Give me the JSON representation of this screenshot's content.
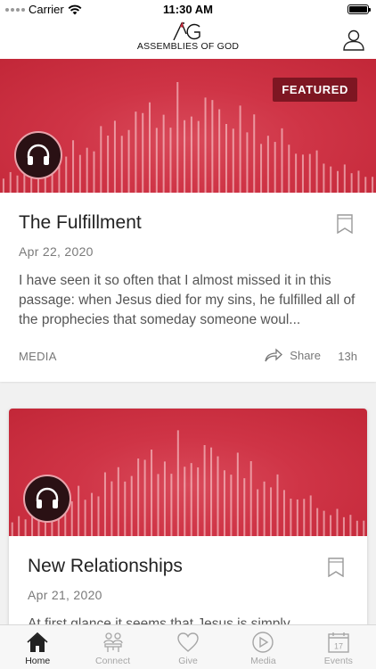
{
  "status_bar": {
    "carrier": "Carrier",
    "time": "11:30 AM"
  },
  "header": {
    "logo_text": "ASSEMBLIES OF GOD",
    "logo_mark": "AG"
  },
  "cards": [
    {
      "badge": "FEATURED",
      "title": "The Fulfillment",
      "date": "Apr 22, 2020",
      "excerpt": "I have seen it so often that I almost missed it in this passage: when Jesus died for my sins, he fulfilled all of the prophecies that someday someone woul...",
      "media_label": "MEDIA",
      "share_label": "Share",
      "age": "13h"
    },
    {
      "title": "New Relationships",
      "date": "Apr 21, 2020",
      "excerpt": "At first glance it seems that Jesus is simply"
    }
  ],
  "tabs": [
    {
      "label": "Home",
      "icon": "home-icon",
      "active": true
    },
    {
      "label": "Connect",
      "icon": "connect-icon",
      "active": false
    },
    {
      "label": "Give",
      "icon": "heart-icon",
      "active": false
    },
    {
      "label": "Media",
      "icon": "play-icon",
      "active": false
    },
    {
      "label": "Events",
      "icon": "calendar-icon",
      "active": false
    }
  ],
  "calendar_day": "17",
  "colors": {
    "brand_red": "#c8283a",
    "badge_bg": "#7e1622",
    "active_tab": "#222222",
    "inactive_tab": "#a6a6a6"
  }
}
